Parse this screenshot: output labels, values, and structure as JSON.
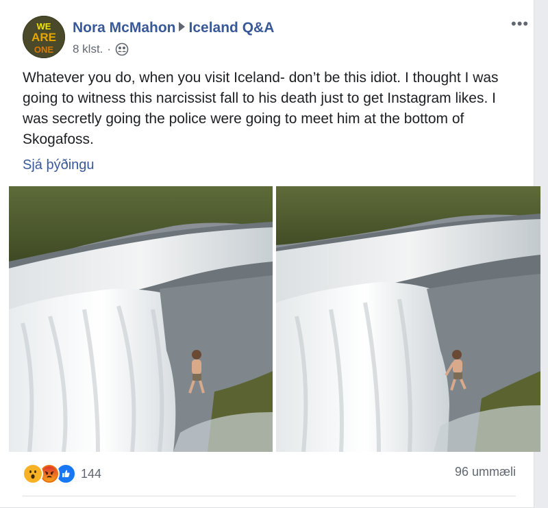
{
  "post": {
    "author": "Nora McMahon",
    "group": "Iceland Q&A",
    "time": "8 klst.",
    "separator": "·",
    "audience_icon": "group-icon",
    "more_icon": "ellipsis-icon",
    "more_glyph": "•••",
    "text": "Whatever you do, when you visit Iceland- don’t be this idiot. I thought I was going to witness this narcissist fall to his death just to get Instagram likes. I was secretly going the police were going to meet him at the bottom of Skogafoss.",
    "translate_link": "Sjá þýðingu",
    "avatar_text": [
      "WE",
      "ARE",
      "ONE"
    ],
    "photos": [
      {
        "icon": "waterfall-photo"
      },
      {
        "icon": "waterfall-photo"
      }
    ]
  },
  "footer": {
    "reactions": [
      {
        "name": "wow",
        "color": "#f7b125"
      },
      {
        "name": "angry",
        "color": "#e9710f"
      },
      {
        "name": "like",
        "color": "#1877f2"
      }
    ],
    "reaction_count": "144",
    "comments": "96 ummæli"
  },
  "colors": {
    "link": "#385898",
    "text": "#1c1e21",
    "muted": "#606770"
  }
}
